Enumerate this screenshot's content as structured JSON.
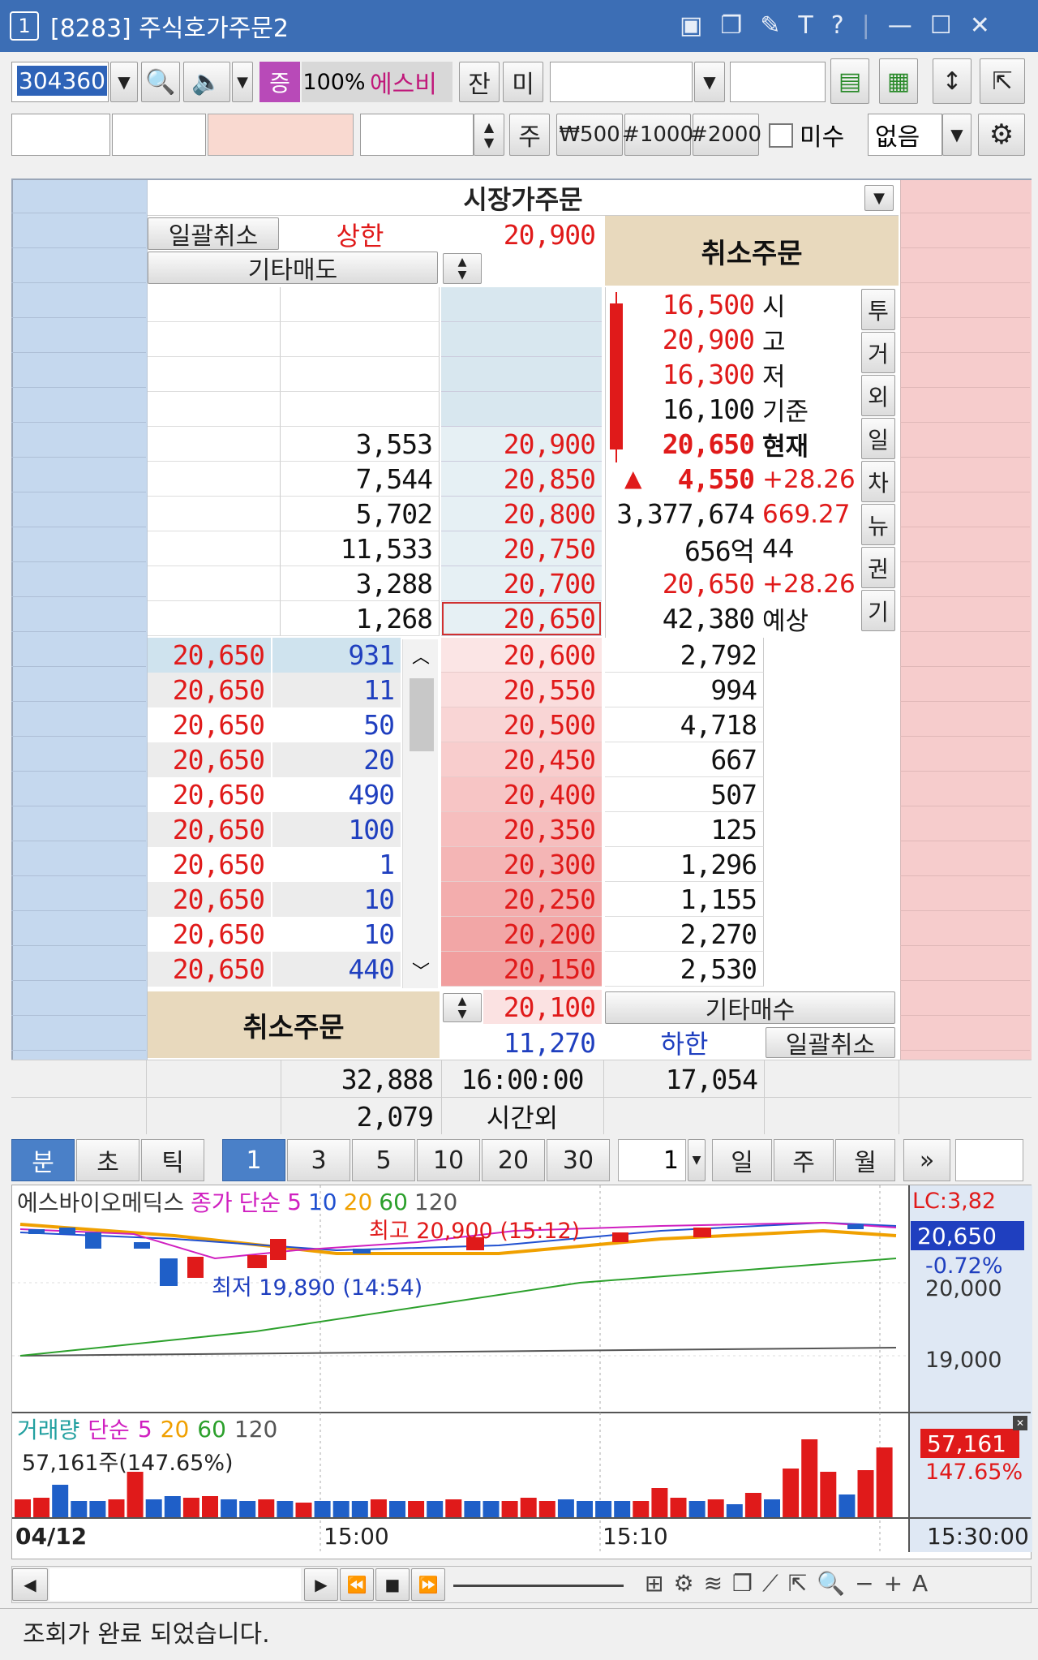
{
  "window": {
    "number": "1",
    "title": "[8283] 주식호가주문2"
  },
  "toolbar1": {
    "code": "304360",
    "zoom": "100%",
    "stock_name": "에스비",
    "bal_label": "잔",
    "mi_label": "미",
    "qty_dropdown": ""
  },
  "toolbar2": {
    "ju_label": "주",
    "q1": "₩500",
    "q2": "#1000",
    "q3": "#2000",
    "misu_label": "미수",
    "condition": "없음"
  },
  "orderbook": {
    "market_order": "시장가주문",
    "bulk_cancel_top": "일괄취소",
    "upper_limit_label": "상한",
    "upper_limit": "20,900",
    "other_sell": "기타매도",
    "cancel_order_top": "취소주문",
    "ask_rows": [
      {
        "qty": "",
        "price": ""
      },
      {
        "qty": "",
        "price": ""
      },
      {
        "qty": "",
        "price": ""
      },
      {
        "qty": "",
        "price": ""
      },
      {
        "qty": "3,553",
        "price": "20,900"
      },
      {
        "qty": "7,544",
        "price": "20,850"
      },
      {
        "qty": "5,702",
        "price": "20,800"
      },
      {
        "qty": "11,533",
        "price": "20,750"
      },
      {
        "qty": "3,288",
        "price": "20,700"
      },
      {
        "qty": "1,268",
        "price": "20,650"
      }
    ],
    "info": [
      {
        "v": "16,500",
        "k": "시"
      },
      {
        "v": "20,900",
        "k": "고"
      },
      {
        "v": "16,300",
        "k": "저"
      },
      {
        "v": "16,100",
        "k": "기준"
      },
      {
        "v": "20,650",
        "k": "현재"
      },
      {
        "v": "4,550",
        "k": "+28.26",
        "arrow": "▲"
      },
      {
        "v": "3,377,674",
        "k": "669.27"
      },
      {
        "v": "656억",
        "k": "44"
      },
      {
        "v": "20,650",
        "k": "+28.26"
      },
      {
        "v": "42,380",
        "k": "예상"
      }
    ],
    "side_tabs": [
      "투",
      "거",
      "외",
      "일",
      "차",
      "뉴",
      "권",
      "기"
    ],
    "fills": [
      {
        "price": "20,650",
        "qty": "931"
      },
      {
        "price": "20,650",
        "qty": "11"
      },
      {
        "price": "20,650",
        "qty": "50"
      },
      {
        "price": "20,650",
        "qty": "20"
      },
      {
        "price": "20,650",
        "qty": "490"
      },
      {
        "price": "20,650",
        "qty": "100"
      },
      {
        "price": "20,650",
        "qty": "1"
      },
      {
        "price": "20,650",
        "qty": "10"
      },
      {
        "price": "20,650",
        "qty": "10"
      },
      {
        "price": "20,650",
        "qty": "440"
      }
    ],
    "bid_rows": [
      {
        "price": "20,600",
        "qty": "2,792"
      },
      {
        "price": "20,550",
        "qty": "994"
      },
      {
        "price": "20,500",
        "qty": "4,718"
      },
      {
        "price": "20,450",
        "qty": "667"
      },
      {
        "price": "20,400",
        "qty": "507"
      },
      {
        "price": "20,350",
        "qty": "125"
      },
      {
        "price": "20,300",
        "qty": "1,296"
      },
      {
        "price": "20,250",
        "qty": "1,155"
      },
      {
        "price": "20,200",
        "qty": "2,270"
      },
      {
        "price": "20,150",
        "qty": "2,530"
      }
    ],
    "bid_last": "20,100",
    "other_buy": "기타매수",
    "cancel_order_bottom": "취소주문",
    "lower_limit": "11,270",
    "lower_limit_label": "하한",
    "bulk_cancel_bottom": "일괄취소",
    "total_ask": "32,888",
    "time": "16:00:00",
    "total_bid": "17,054",
    "afterhours_qty": "2,079",
    "afterhours_label": "시간외"
  },
  "chart_tabs": {
    "units": [
      "분",
      "초",
      "틱"
    ],
    "intervals": [
      "1",
      "3",
      "5",
      "10",
      "20",
      "30"
    ],
    "count": "1",
    "periods": [
      "일",
      "주",
      "월"
    ]
  },
  "chart": {
    "stock": "에스바이오메딕스",
    "close_label": "종가",
    "ma_label": "단순",
    "ma": [
      "5",
      "10",
      "20",
      "60",
      "120"
    ],
    "high_note": "최고 20,900 (15:12)",
    "low_note": "최저 19,890 (14:54)",
    "lc": "LC:3,82",
    "price_badge": "20,650",
    "change": "-0.72%",
    "y_ticks": [
      "20,000",
      "19,000"
    ],
    "vol_label": "거래량",
    "vol_ma_label": "단순",
    "vol_ma": [
      "5",
      "20",
      "60",
      "120"
    ],
    "vol_note": "57,161주(147.65%)",
    "vol_badge": "57,161",
    "vol_pct": "147.65%",
    "x_labels": [
      "04/12",
      "15:00",
      "15:10",
      "15:30:00"
    ]
  },
  "colors": {
    "ask_blue": "#c5d8ee",
    "bid_pink": "#f6cccc",
    "cancel_tan": "#e8d9bd",
    "red": "#e01a1a",
    "blue": "#1f3fbf"
  },
  "status": "조회가 완료 되었습니다."
}
